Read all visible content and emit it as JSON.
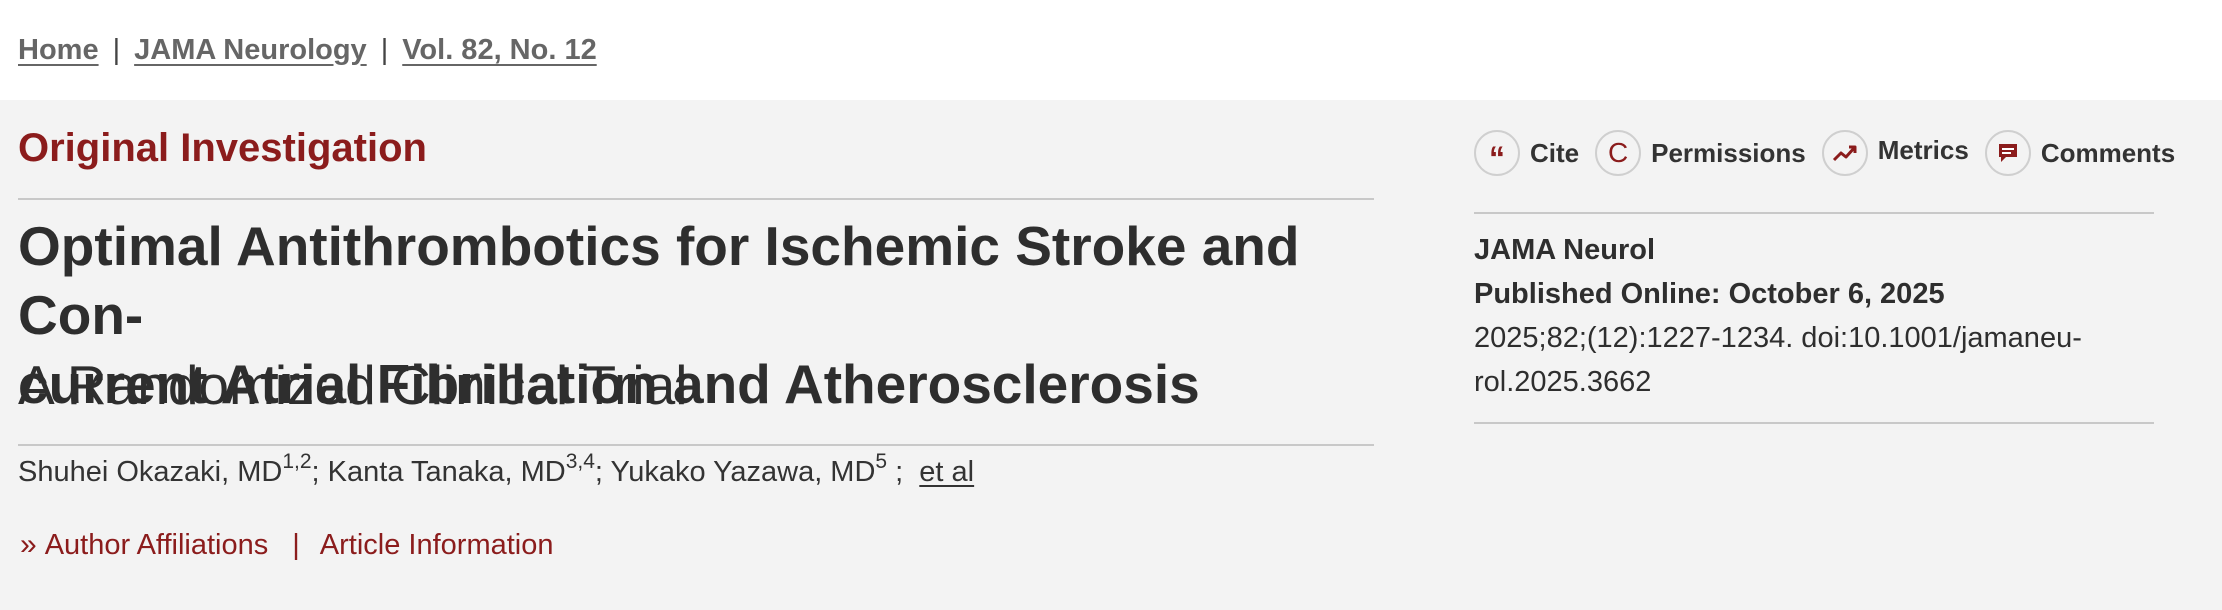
{
  "breadcrumb": {
    "items": [
      "Home",
      "JAMA Neurology",
      "Vol. 82, No. 12"
    ],
    "separator": "|"
  },
  "article": {
    "type": "Original Investigation",
    "title_line1": "Optimal Antithrombotics for Ischemic Stroke and Con-",
    "title_line2": "current Atrial Fibrillation and Atherosclerosis",
    "subtitle": "A Randomized Clinical Trial",
    "authors": [
      {
        "name": "Shuhei Okazaki, MD",
        "sup": "1,2"
      },
      {
        "name": "Kanta Tanaka, MD",
        "sup": "3,4"
      },
      {
        "name": "Yukako Yazawa, MD",
        "sup": "5"
      }
    ],
    "author_sep": ";",
    "etal": "et al",
    "links": {
      "chevron": "»",
      "affiliations": "Author Affiliations",
      "divider": "|",
      "info": "Article Information"
    }
  },
  "tools": [
    {
      "label": "Cite",
      "icon": "quote-icon",
      "glyph": "“"
    },
    {
      "label": "Permissions",
      "icon": "copyright-icon",
      "glyph": "C"
    },
    {
      "label": "Metrics",
      "icon": "trend-icon",
      "glyph": ""
    },
    {
      "label": "Comments",
      "icon": "comment-icon",
      "glyph": ""
    }
  ],
  "citation": {
    "journal": "JAMA Neurol",
    "published": "Published Online: October 6, 2025",
    "ref_line1": "2025;82;(12):1227-1234. doi:10.1001/jamaneu-",
    "ref_line2": "rol.2025.3662"
  },
  "colors": {
    "accent": "#8b1c1c",
    "text": "#333333",
    "band": "#f3f3f3"
  }
}
